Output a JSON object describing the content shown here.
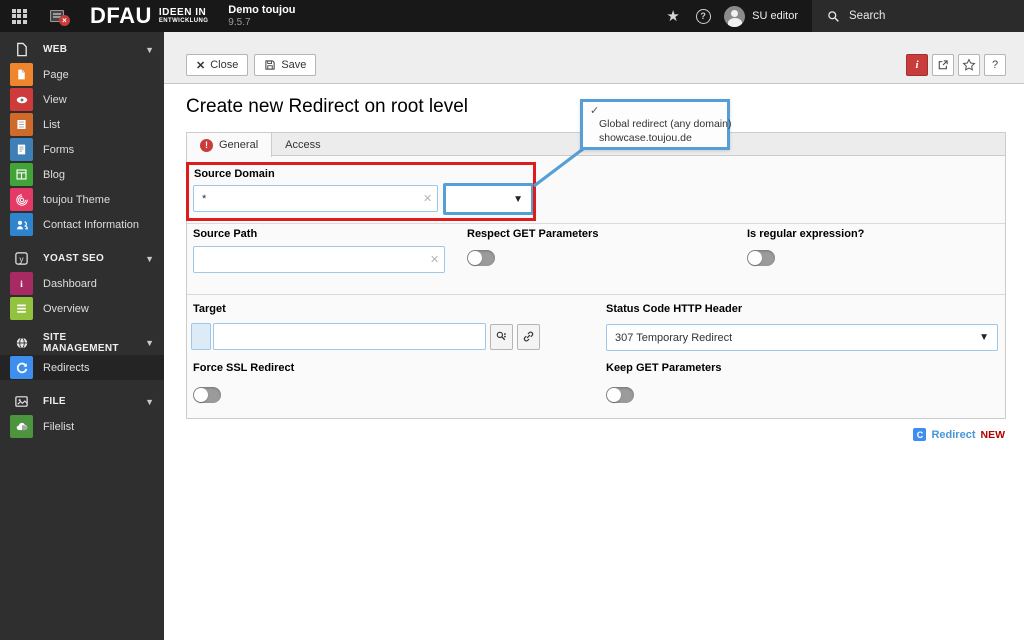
{
  "topbar": {
    "brand": "DFAU",
    "brand_tagline_line1": "IDEEN IN",
    "brand_tagline_line2": "ENTWICKLUNG",
    "site_name": "Demo toujou",
    "site_version": "9.5.7",
    "user_name": "SU editor",
    "search_label": "Search"
  },
  "sidebar": {
    "sections": [
      {
        "label": "WEB",
        "icon": "web-document-icon",
        "items": [
          {
            "label": "Page",
            "icon": "page-icon",
            "color": "#ef852c"
          },
          {
            "label": "View",
            "icon": "view-eye-icon",
            "color": "#cf3b3b"
          },
          {
            "label": "List",
            "icon": "list-icon",
            "color": "#d06a2a"
          },
          {
            "label": "Forms",
            "icon": "forms-icon",
            "color": "#3e7fb8"
          },
          {
            "label": "Blog",
            "icon": "blog-icon",
            "color": "#42a339"
          },
          {
            "label": "toujou Theme",
            "icon": "fingerprint-icon",
            "color": "#e43a67"
          },
          {
            "label": "Contact Information",
            "icon": "contacts-icon",
            "color": "#2f85cd"
          }
        ]
      },
      {
        "label": "YOAST SEO",
        "icon": "yoast-icon",
        "items": [
          {
            "label": "Dashboard",
            "icon": "dashboard-icon",
            "color": "#a82a63"
          },
          {
            "label": "Overview",
            "icon": "overview-icon",
            "color": "#92c23e"
          }
        ]
      },
      {
        "label": "SITE MANAGEMENT",
        "icon": "globe-icon",
        "items": [
          {
            "label": "Redirects",
            "icon": "redirects-icon",
            "color": "#3e8ef0",
            "active": true
          }
        ]
      },
      {
        "label": "FILE",
        "icon": "image-icon",
        "items": [
          {
            "label": "Filelist",
            "icon": "filelist-icon",
            "color": "#4c9440"
          }
        ]
      }
    ]
  },
  "docheader": {
    "close_label": "Close",
    "save_label": "Save",
    "info_label": "i",
    "help_label": "?"
  },
  "page": {
    "title": "Create new Redirect on root level",
    "tabs": [
      {
        "label": "General"
      },
      {
        "label": "Access"
      }
    ]
  },
  "form": {
    "source_domain": {
      "label": "Source Domain",
      "value": "*"
    },
    "source_path": {
      "label": "Source Path",
      "value": ""
    },
    "respect_get_parameters": {
      "label": "Respect GET Parameters",
      "state": "off"
    },
    "is_regular_expression": {
      "label": "Is regular expression?",
      "state": "off"
    },
    "target": {
      "label": "Target",
      "value": ""
    },
    "status_code": {
      "label": "Status Code HTTP Header",
      "selected": "307 Temporary Redirect"
    },
    "force_ssl_redirect": {
      "label": "Force SSL Redirect",
      "state": "off"
    },
    "keep_get_parameters": {
      "label": "Keep GET Parameters",
      "state": "off"
    }
  },
  "dropdown_popup": {
    "selected_mark": "✓",
    "option_line1": "Global redirect (any domain)",
    "option_line2": "showcase.toujou.de"
  },
  "footer": {
    "record_type": "Redirect",
    "record_status": "NEW"
  },
  "colors": {
    "annotation_red": "#e01b1b",
    "annotation_blue": "#569fd6",
    "danger_red": "#c83c3c",
    "redirect_blue": "#3e8ef0"
  }
}
